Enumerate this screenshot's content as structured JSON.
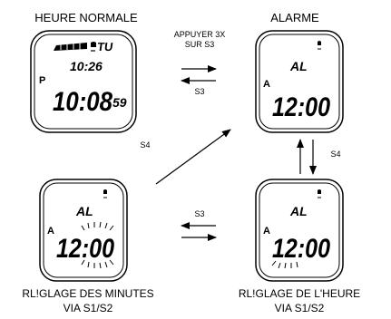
{
  "titles": {
    "normal_time": "HEURE NORMALE",
    "alarm": "ALARME"
  },
  "captions": {
    "minutes_line1": "RL!GLAGE DES MINUTES",
    "minutes_line2": "VIA S1/S2",
    "hours_line1": "RL!GLAGE DE L'HEURE",
    "hours_line2": "VIA S1/S2"
  },
  "buttons": {
    "press3x_line1": "APPUYER 3X",
    "press3x_line2": "SUR S3",
    "s3_top": "S3",
    "s4_diag": "S4",
    "s4_right": "S4",
    "s3_bottom": "S3"
  },
  "watch_normal": {
    "day": "TU",
    "date": "10:26",
    "pm": "P",
    "time": "10:08",
    "seconds": "59"
  },
  "watch_alarm": {
    "mode": "AL",
    "ampm": "A",
    "time": "12:00"
  },
  "watch_hours": {
    "mode": "AL",
    "ampm": "A",
    "time": "12:00"
  },
  "watch_minutes": {
    "mode": "AL",
    "ampm": "A",
    "time": "12:00"
  }
}
